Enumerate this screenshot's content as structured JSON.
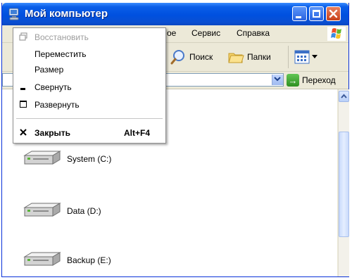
{
  "window": {
    "title": "Мой компьютер"
  },
  "menubar": {
    "partial_item": "ое",
    "items": [
      "Сервис",
      "Справка"
    ]
  },
  "toolbar": {
    "search_label": "Поиск",
    "folders_label": "Папки"
  },
  "addressbar": {
    "go_label": "Переход"
  },
  "drives": [
    {
      "label": "System (C:)",
      "icon": "hard-drive-icon"
    },
    {
      "label": "Data (D:)",
      "icon": "hard-drive-icon"
    },
    {
      "label": "Backup (E:)",
      "icon": "hard-drive-icon"
    }
  ],
  "system_menu": {
    "items": [
      {
        "label": "Восстановить",
        "enabled": false,
        "icon": "restore-icon"
      },
      {
        "label": "Переместить",
        "enabled": true
      },
      {
        "label": "Размер",
        "enabled": true
      },
      {
        "label": "Свернуть",
        "enabled": true,
        "icon": "minimize-icon"
      },
      {
        "label": "Развернуть",
        "enabled": true,
        "icon": "maximize-icon"
      },
      {
        "label": "Закрыть",
        "enabled": true,
        "icon": "close-icon",
        "shortcut": "Alt+F4",
        "bold": true
      }
    ]
  },
  "colors": {
    "titlebar": "#0050df",
    "menu_disabled_text": "#9d9d9d",
    "go_arrow": "#2f8f22"
  }
}
